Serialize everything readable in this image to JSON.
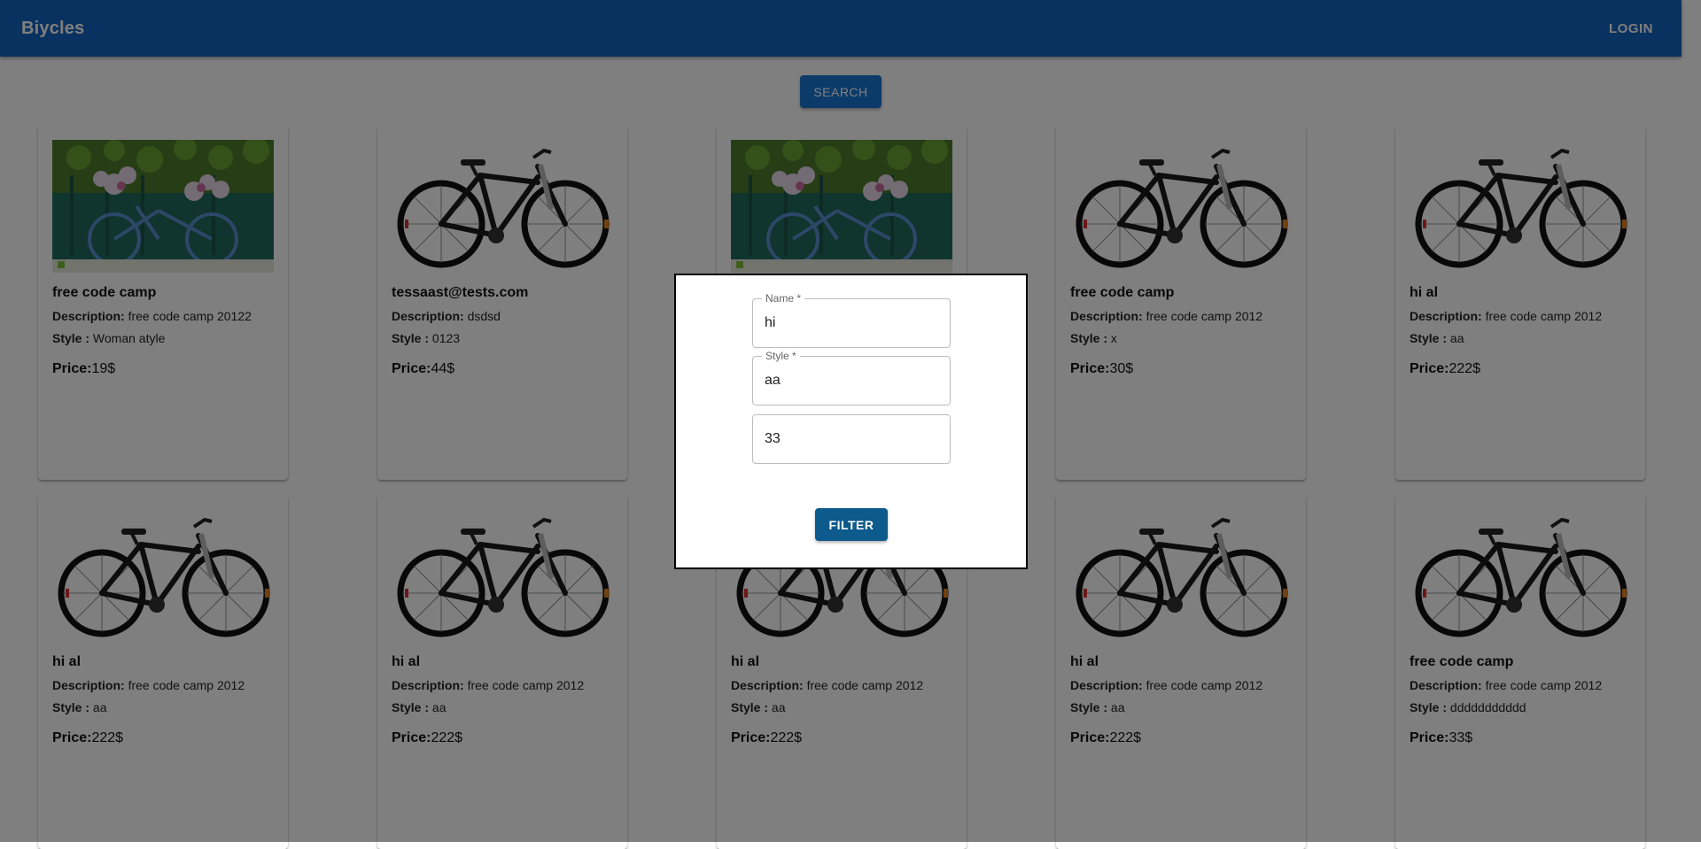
{
  "appbar": {
    "title": "Biycles",
    "login_label": "LOGIN"
  },
  "search_label": "SEARCH",
  "card_labels": {
    "description": "Description:",
    "style": "Style :",
    "price": "Price:"
  },
  "cards": [
    {
      "image": "flowers-bike-photo",
      "name": "free code camp",
      "description": "free code camp 20122",
      "style": "Woman atyle",
      "price": "19$"
    },
    {
      "image": "black-bike-photo",
      "name": "tessaast@tests.com",
      "description": "dsdsd",
      "style": "0123",
      "price": "44$"
    },
    {
      "image": "flowers-bike-photo",
      "name": "",
      "description": "",
      "style": "",
      "price": ""
    },
    {
      "image": "black-bike-photo",
      "name": "free code camp",
      "description": "free code camp 2012",
      "style": "x",
      "price": "30$"
    },
    {
      "image": "black-bike-photo",
      "name": "hi al",
      "description": "free code camp 2012",
      "style": "aa",
      "price": "222$"
    },
    {
      "image": "black-bike-photo",
      "name": "hi al",
      "description": "free code camp 2012",
      "style": "aa",
      "price": "222$"
    },
    {
      "image": "black-bike-photo",
      "name": "hi al",
      "description": "free code camp 2012",
      "style": "aa",
      "price": "222$"
    },
    {
      "image": "black-bike-photo",
      "name": "hi al",
      "description": "free code camp 2012",
      "style": "aa",
      "price": "222$"
    },
    {
      "image": "black-bike-photo",
      "name": "hi al",
      "description": "free code camp 2012",
      "style": "aa",
      "price": "222$"
    },
    {
      "image": "black-bike-photo",
      "name": "free code camp",
      "description": "free code camp 2012",
      "style": "ddddddddddd",
      "price": "33$"
    }
  ],
  "modal": {
    "name_field": {
      "label": "Name *",
      "value": "hi"
    },
    "style_field": {
      "label": "Style *",
      "value": "aa"
    },
    "price_field": {
      "value": "33"
    },
    "filter_label": "FILTER"
  },
  "colors": {
    "appbar": "#1565c0",
    "button": "#1976d2",
    "overlay": "rgba(0,0,0,0.5)"
  }
}
